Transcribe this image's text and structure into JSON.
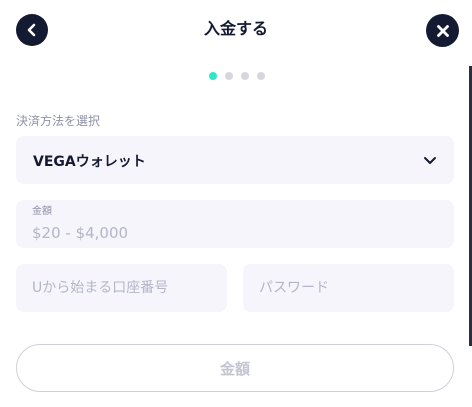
{
  "header": {
    "title": "入金する",
    "back_icon": "chevron-left-icon",
    "close_icon": "close-icon"
  },
  "steps": {
    "total": 4,
    "current": 1
  },
  "payment": {
    "section_label": "決済方法を選択",
    "selected_method": "VEGAウォレット"
  },
  "amount": {
    "label": "金額",
    "placeholder": "$20 - $4,000"
  },
  "account": {
    "placeholder": "Uから始まる口座番号"
  },
  "password": {
    "placeholder": "パスワード"
  },
  "submit": {
    "label": "金額"
  },
  "colors": {
    "primary_dark": "#151a33",
    "accent": "#2ee6c8",
    "field_bg": "#f5f5fb"
  }
}
